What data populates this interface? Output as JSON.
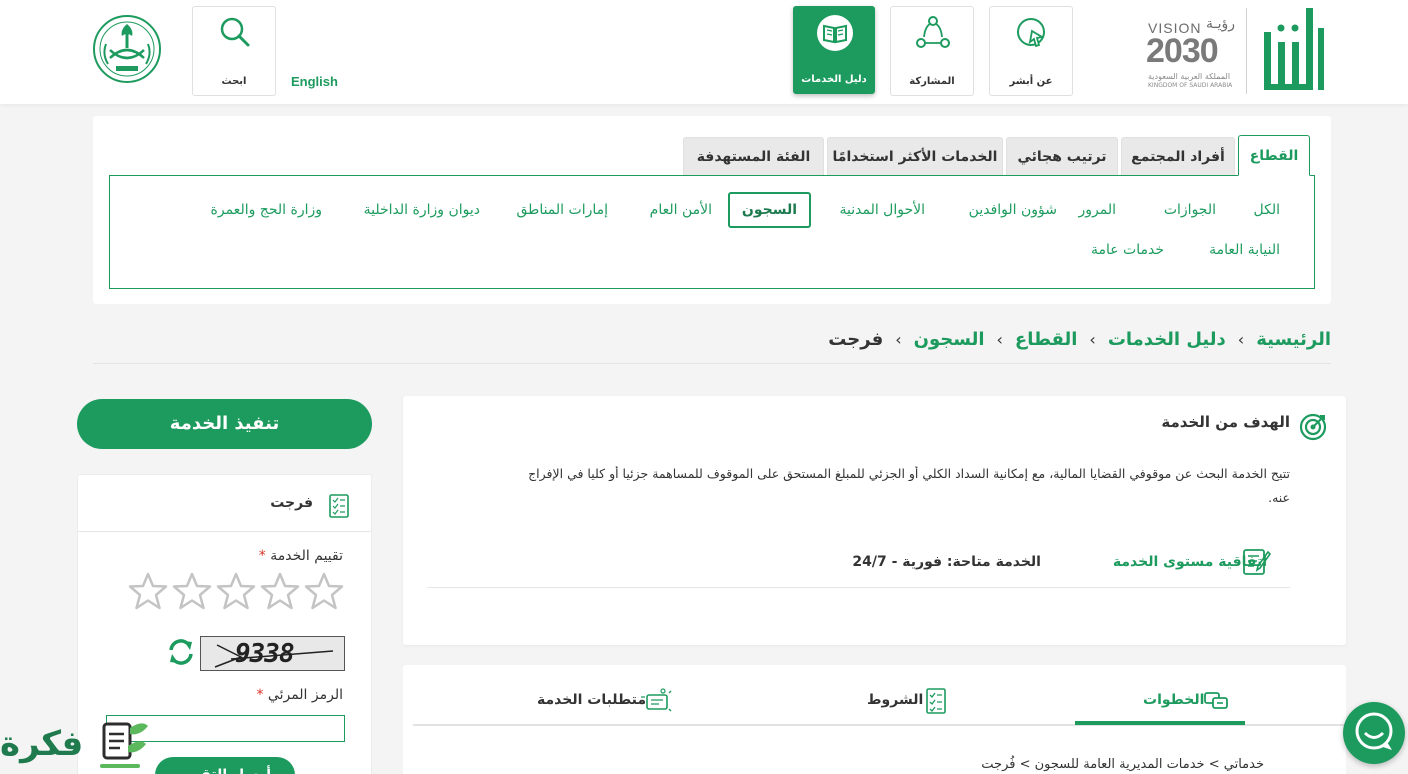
{
  "header": {
    "vision_text": "VISION",
    "vision_ar": "رؤيـة",
    "vision_year": "2030",
    "kingdom_ar": "المملكة العربية السعودية",
    "kingdom_en": "KINGDOM OF SAUDI ARABIA",
    "brand_ar": "أبشر",
    "nav": {
      "about": "عن أبشر",
      "participation": "المشاركة",
      "services_guide": "دليل الخدمات",
      "search": "ابحث"
    },
    "language": "English"
  },
  "sector": {
    "tabs": [
      "القطاع",
      "أفراد المجتمع",
      "ترتيب هجائي",
      "الخدمات الأكثر استخدامًا",
      "الفئة المستهدفة"
    ],
    "categories_row1": [
      "الكل",
      "الجوازات",
      "المرور",
      "شؤون الوافدين",
      "الأحوال المدنية",
      "السجون",
      "الأمن العام",
      "إمارات المناطق",
      "ديوان وزارة الداخلية",
      "وزارة الحج والعمرة"
    ],
    "categories_row2": [
      "النيابة العامة",
      "خدمات عامة"
    ],
    "active_category": "السجون"
  },
  "breadcrumb": {
    "home": "الرئيسية",
    "guide": "دليل الخدمات",
    "sector": "القطاع",
    "prisons": "السجون",
    "current": "فرجت"
  },
  "goal": {
    "title": "الهدف من الخدمة",
    "line1": "تتيح الخدمة البحث عن موقوفي القضايا المالية، مع إمكانية السداد الكلي أو الجزئي للمبلغ المستحق على الموقوف للمساهمة جزئيا أو كليا في الإفراج",
    "line2": "عنه.",
    "sla_label": "اتفاقية مستوى الخدمة",
    "sla_value": "الخدمة متاحة: فورية - 24/7"
  },
  "content_tabs": {
    "steps": "الخطوات",
    "terms": "الشروط",
    "requirements": "متطلبات الخدمة",
    "path": "خدماتي > خدمات المديرية العامة للسجون > فُرجت"
  },
  "side": {
    "execute_label": "تنفيذ الخدمة",
    "service_name": "فرجت",
    "rating_label": "تقييم الخدمة",
    "rating_value": 0,
    "captcha_text": "9338",
    "captcha_label": "الرمز المرئي",
    "captcha_value": "",
    "send_label": "أرسل التقييم",
    "required_mark": "*"
  },
  "watermark": {
    "text": "فكرة"
  },
  "colors": {
    "accent": "#1d9b5e",
    "required": "#d9342b"
  }
}
